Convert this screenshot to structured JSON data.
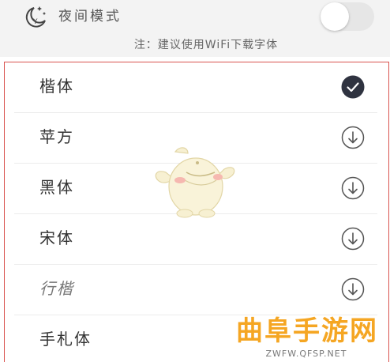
{
  "night_mode": {
    "label": "夜间模式",
    "icon": "moon-stars-icon",
    "enabled": false
  },
  "note": "注：建议使用WiFi下载字体",
  "fonts": [
    {
      "name": "楷体",
      "status": "selected",
      "icon": "check-circle-icon"
    },
    {
      "name": "苹方",
      "status": "download",
      "icon": "download-icon"
    },
    {
      "name": "黑体",
      "status": "download",
      "icon": "download-icon"
    },
    {
      "name": "宋体",
      "status": "download",
      "icon": "download-icon"
    },
    {
      "name": "行楷",
      "status": "download",
      "icon": "download-icon"
    },
    {
      "name": "手札体",
      "status": "none"
    }
  ],
  "watermark": {
    "title": "曲阜手游网",
    "url": "ZWFW.QFSP.NET"
  },
  "colors": {
    "panel_border": "#d9534f",
    "selected": "#2f3340",
    "watermark": "#f5a623"
  }
}
